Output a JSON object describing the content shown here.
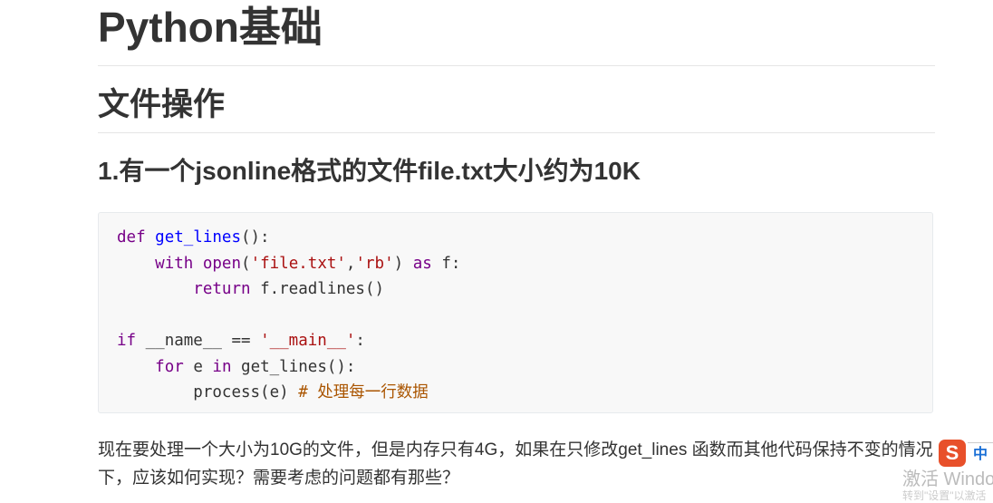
{
  "h1": "Python基础",
  "h2": "文件操作",
  "h3": "1.有一个jsonline格式的文件file.txt大小约为10K",
  "code": {
    "l1": {
      "kw": "def",
      "fn": "get_lines",
      "rest": "():"
    },
    "l2": {
      "kw": "with",
      "fn": "open",
      "p1": "(",
      "s1": "'file.txt'",
      "c": ",",
      "s2": "'rb'",
      "p2": ")",
      "kw2": "as",
      "rest": "f:"
    },
    "l3": {
      "kw": "return",
      "rest": "f.readlines()"
    },
    "l5": {
      "kw": "if",
      "mid": "__name__ == ",
      "s": "'__main__'",
      "rest": ":"
    },
    "l6": {
      "kw": "for",
      "mid": "e",
      "kw2": "in",
      "rest": "get_lines():"
    },
    "l7": {
      "rest": "process(e)",
      "comment": "# 处理每一行数据"
    }
  },
  "paragraph": "现在要处理一个大小为10G的文件，但是内存只有4G，如果在只修改get_lines 函数而其他代码保持不变的情况下，应该如何实现？需要考虑的问题都有那些？",
  "ime": {
    "logo": "S",
    "mode": "中"
  },
  "watermark": {
    "line1": "激活 Windows",
    "line2": "转到\"设置\"以激活"
  }
}
